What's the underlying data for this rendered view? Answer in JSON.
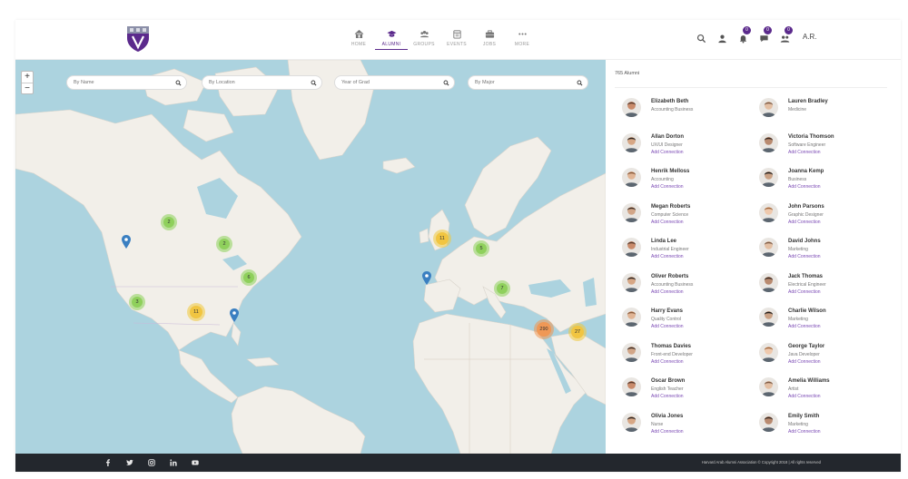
{
  "nav": {
    "items": [
      {
        "label": "HOME",
        "icon": "home-icon"
      },
      {
        "label": "ALUMNI",
        "icon": "graduation-cap-icon",
        "active": true
      },
      {
        "label": "GROUPS",
        "icon": "users-icon"
      },
      {
        "label": "EVENTS",
        "icon": "calendar-icon"
      },
      {
        "label": "JOBS",
        "icon": "briefcase-icon"
      },
      {
        "label": "MORE",
        "icon": "ellipsis-icon"
      }
    ]
  },
  "header_right": {
    "badges": [
      "0",
      "0",
      "0"
    ],
    "initials": "A.R."
  },
  "filters": {
    "name_placeholder": "By Name",
    "location_placeholder": "By Location",
    "grad_year_placeholder": "Year of Grad",
    "major_placeholder": "By Major"
  },
  "map": {
    "zoom_in": "+",
    "zoom_out": "−",
    "clusters": [
      {
        "label": "2",
        "color": "green"
      },
      {
        "label": "2",
        "color": "green"
      },
      {
        "label": "6",
        "color": "green"
      },
      {
        "label": "3",
        "color": "green"
      },
      {
        "label": "11",
        "color": "yellow"
      },
      {
        "label": "11",
        "color": "yellow"
      },
      {
        "label": "5",
        "color": "green"
      },
      {
        "label": "7",
        "color": "green"
      },
      {
        "label": "290",
        "color": "orange"
      },
      {
        "label": "27",
        "color": "yellow"
      }
    ],
    "colors": {
      "water": "#acd3df",
      "land": "#f2efe9",
      "marker": "#3a7fc1",
      "accent": "#5b2a8c"
    }
  },
  "sidebar": {
    "count_label": "765 Alumni",
    "add_label": "Add Connection",
    "alumni": [
      {
        "name": "Elizabeth Beth",
        "role": "Accounting Business"
      },
      {
        "name": "Lauren Bradley",
        "role": "Medicine"
      },
      {
        "name": "Allan Dorton",
        "role": "UX/UI Designer"
      },
      {
        "name": "Victoria Thomson",
        "role": "Software Engineer"
      },
      {
        "name": "Henrik Melloss",
        "role": "Accounting"
      },
      {
        "name": "Joanna Kemp",
        "role": "Business"
      },
      {
        "name": "Megan Roberts",
        "role": "Computer Science"
      },
      {
        "name": "John Parsons",
        "role": "Graphic Designer"
      },
      {
        "name": "Linda Lee",
        "role": "Industrial Engineer"
      },
      {
        "name": "David Johns",
        "role": "Marketing"
      },
      {
        "name": "Oliver Roberts",
        "role": "Accounting Business"
      },
      {
        "name": "Jack Thomas",
        "role": "Electrical Engineer"
      },
      {
        "name": "Harry Evans",
        "role": "Quality Control"
      },
      {
        "name": "Charlie Wilson",
        "role": "Marketing"
      },
      {
        "name": "Thomas Davies",
        "role": "Front-end Developer"
      },
      {
        "name": "George Taylor",
        "role": "Java Developer"
      },
      {
        "name": "Oscar Brown",
        "role": "English Teacher"
      },
      {
        "name": "Amelia Williams",
        "role": "Artist"
      },
      {
        "name": "Olivia Jones",
        "role": "Nurse"
      },
      {
        "name": "Emily Smith",
        "role": "Marketing"
      }
    ]
  },
  "footer": {
    "social": [
      "facebook-icon",
      "twitter-icon",
      "instagram-icon",
      "linkedin-icon",
      "youtube-icon"
    ],
    "copyright": "Harvard Arab Alumni Association © Copyright 2018 | All rights reserved"
  }
}
